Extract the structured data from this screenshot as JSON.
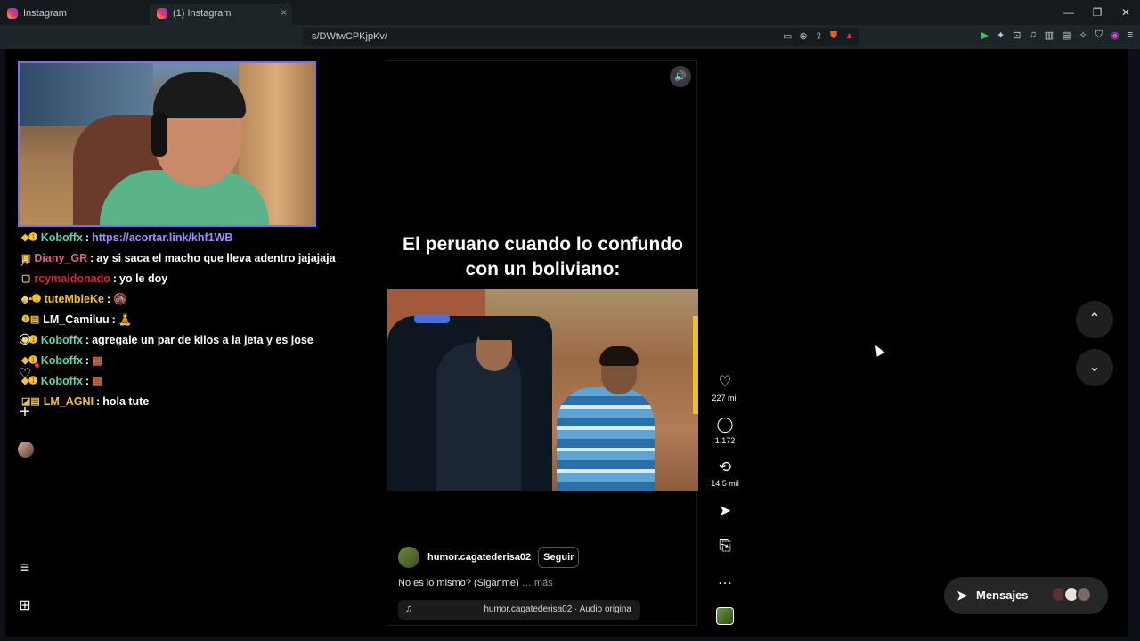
{
  "browser": {
    "tabs": [
      {
        "label": "Instagram"
      },
      {
        "label": "(1) Instagram",
        "close": "×"
      }
    ],
    "window_controls": {
      "minimize": "—",
      "restore": "❐",
      "close": "✕"
    },
    "url": "s/DWtwCPKjpKv/",
    "url_icons": [
      "cast-icon",
      "zoom-icon",
      "share-icon",
      "brave-shield-icon",
      "rewards-icon"
    ],
    "extensions": [
      "play-extension-icon",
      "puzzle-icon",
      "screenshot-icon",
      "music-icon",
      "sidebar-icon",
      "wallet-icon",
      "leo-icon",
      "vpn-icon",
      "extension-icon",
      "menu-icon"
    ]
  },
  "chat": [
    {
      "badges": "◆➊",
      "user": "Koboffx",
      "user_color": "#5fd3a8",
      "message": "https://acortar.link/khf1WB",
      "is_link": true
    },
    {
      "badges": "▣",
      "user": "Diany_GR",
      "user_color": "#e0607a",
      "message": "ay si saca el macho que lleva adentro jajajaja",
      "is_link": false
    },
    {
      "badges": "▢",
      "user": "rcymaldonado",
      "user_color": "#d12a3a",
      "message": "yo le doy",
      "is_link": false
    },
    {
      "badges": "◆▪➊",
      "user": "tuteMbleKe",
      "user_color": "#f5c331",
      "message": "🚳",
      "is_link": false
    },
    {
      "badges": "❶▤",
      "user": "LM_Camiluu",
      "user_color": "#ffffff",
      "message": "🧘",
      "is_link": false
    },
    {
      "badges": "◆➊",
      "user": "Koboffx",
      "user_color": "#5fd3a8",
      "message": "agregale un par de kilos a la jeta y es jose",
      "is_link": false
    },
    {
      "badges": "◆➊",
      "user": "Koboffx",
      "user_color": "#5fd3a8",
      "message": "▦",
      "is_link": false
    },
    {
      "badges": "◆➊",
      "user": "Koboffx",
      "user_color": "#5fd3a8",
      "message": "▦",
      "is_link": false
    },
    {
      "badges": "◪▤",
      "user": "LM_AGNI",
      "user_color": "#f5c331",
      "message": "hola tute",
      "is_link": false
    }
  ],
  "sidebar_icons": [
    "explore-icon",
    "search-icon",
    "compass-icon",
    "heart-icon",
    "plus-icon",
    "profile-avatar",
    "menu-icon",
    "more-apps-icon"
  ],
  "reel": {
    "overlay_caption": "El peruano cuando lo confundo con un boliviano:",
    "sound_icon": "🔊",
    "author": "humor.cagatederisa02",
    "follow_label": "Seguir",
    "description": "No es lo mismo? (Siganme)",
    "more_label": "… más",
    "audio_text": "humor.cagatederisa02 · Audio origina"
  },
  "actions": {
    "like": {
      "icon": "♡",
      "count": "227 mil"
    },
    "comment": {
      "icon": "◯",
      "count": "1.172"
    },
    "repost": {
      "icon": "⟲",
      "count": "14,5 mil"
    },
    "share": {
      "icon": "➤"
    },
    "save": {
      "icon": "⎘"
    },
    "more": {
      "icon": "…"
    }
  },
  "nav": {
    "up": "⌃",
    "down": "⌄"
  },
  "messages": {
    "label": "Mensajes",
    "icon": "➤"
  },
  "colors": {
    "accent_purple": "#7b6cf0",
    "link": "#a08cff",
    "notification": "#ff3040"
  }
}
